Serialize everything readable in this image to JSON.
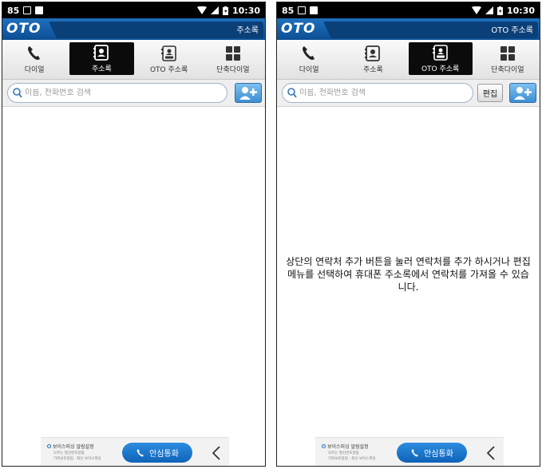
{
  "status_bar": {
    "notification_count": "85",
    "time": "10:30"
  },
  "app": {
    "logo": "OTO"
  },
  "tabs": [
    {
      "label": "다이얼",
      "icon": "phone-icon"
    },
    {
      "label": "주소록",
      "icon": "contacts-icon"
    },
    {
      "label": "OTO 주소록",
      "icon": "oto-contacts-icon"
    },
    {
      "label": "단축다이얼",
      "icon": "speed-dial-icon"
    }
  ],
  "search": {
    "placeholder": "이름, 전화번호 검색"
  },
  "screens": [
    {
      "title": "주소록",
      "active_tab": "주소록"
    },
    {
      "title": "OTO 주소록",
      "active_tab": "OTO 주소록",
      "edit_label": "편집",
      "empty_message": "상단의 연락처 추가 버튼을 눌러 연락처를 추가 하시거나 편집 메뉴를 선택하여 휴대폰 주소록에서 연락처를 가져올 수 있습니다."
    }
  ],
  "ad_bar": {
    "line1": "보이스피싱 알림설정",
    "line2": "모르는 발신번호알림",
    "line3": "가족보호알림 · 최신 보이스피싱",
    "call_label": "안심통화"
  },
  "colors": {
    "title_bar": "#1e70bd",
    "active_tab": "#0b0b0b",
    "call_button": "#1a78cc"
  }
}
